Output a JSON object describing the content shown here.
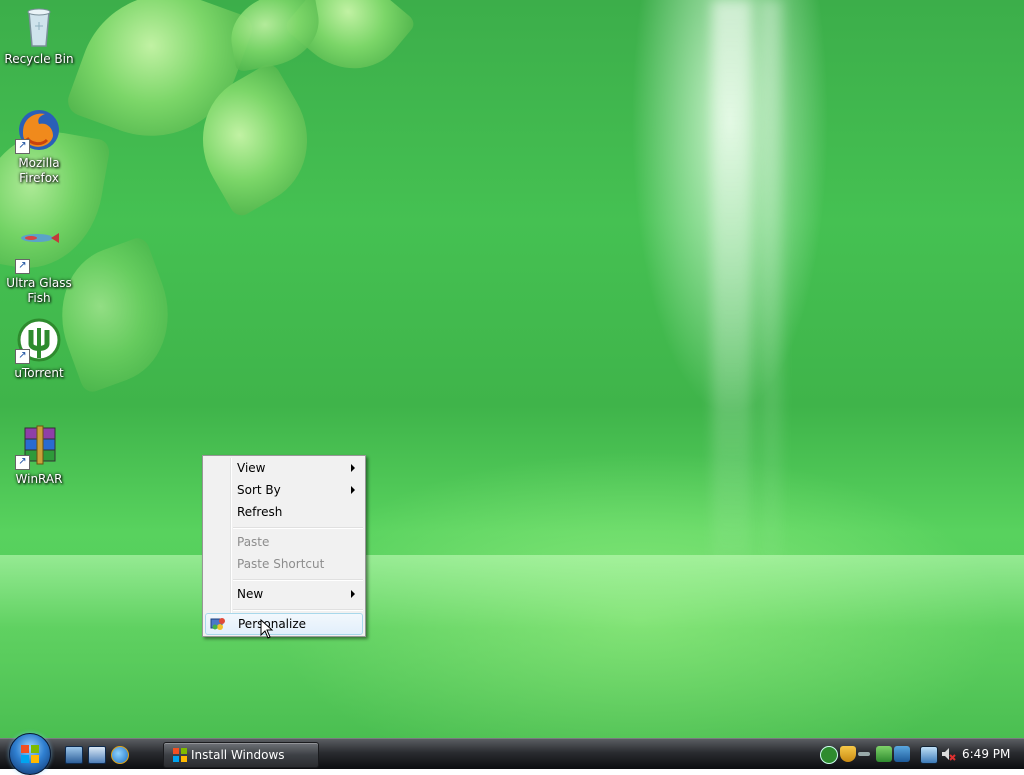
{
  "desktop": {
    "icons": [
      {
        "label": "Recycle Bin",
        "icon": "recycle-bin-icon"
      },
      {
        "label": "Mozilla Firefox",
        "icon": "firefox-icon"
      },
      {
        "label": "Ultra Glass Fish",
        "icon": "fish-icon"
      },
      {
        "label": "uTorrent",
        "icon": "utorrent-icon"
      },
      {
        "label": "WinRAR",
        "icon": "winrar-icon"
      }
    ]
  },
  "context_menu": {
    "items": [
      {
        "label": "View",
        "submenu": true,
        "enabled": true
      },
      {
        "label": "Sort By",
        "submenu": true,
        "enabled": true
      },
      {
        "label": "Refresh",
        "submenu": false,
        "enabled": true
      },
      {
        "label": "Paste",
        "submenu": false,
        "enabled": false
      },
      {
        "label": "Paste Shortcut",
        "submenu": false,
        "enabled": false
      },
      {
        "label": "New",
        "submenu": true,
        "enabled": true
      },
      {
        "label": "Personalize",
        "submenu": false,
        "enabled": true,
        "highlighted": true,
        "icon": "personalize-icon"
      }
    ]
  },
  "taskbar": {
    "start_icon": "windows-orb-icon",
    "quick_launch": [
      "show-desktop-icon",
      "switch-windows-icon",
      "internet-explorer-icon"
    ],
    "window_buttons": [
      {
        "label": "Install Windows",
        "icon": "windows-setup-icon"
      }
    ],
    "tray_icons": [
      "utorrent-tray-icon",
      "security-shield-icon",
      "network-connection-icon",
      "media-icon",
      "app-tray-icon",
      "network-icon",
      "volume-muted-icon"
    ],
    "clock": "6:49 PM"
  },
  "colors": {
    "wallpaper_green": "#45c152",
    "menu_background": "#f1f1f1",
    "menu_highlight_border": "#a8d8eb",
    "taskbar_dark": "#0c0d10"
  }
}
